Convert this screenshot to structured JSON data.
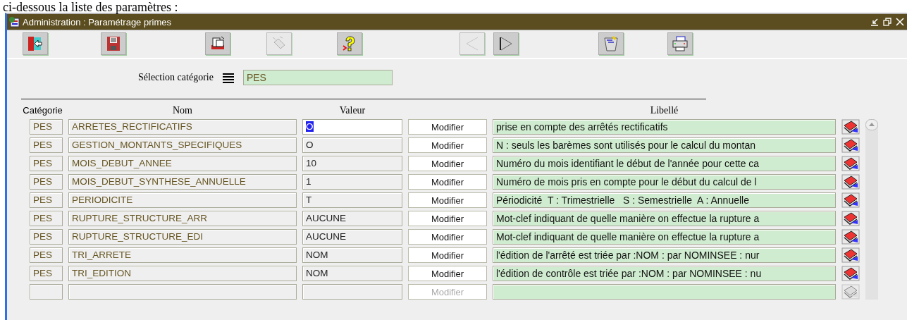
{
  "page_caption": "ci-dessous la liste des paramètres :",
  "window": {
    "title": "Administration : Paramétrage primes"
  },
  "toolbar": [
    {
      "kind": "exit",
      "disabled": false
    },
    {
      "kind": "save",
      "disabled": false
    },
    {
      "kind": "copy",
      "disabled": false
    },
    {
      "kind": "eraser",
      "disabled": true
    },
    {
      "kind": "help",
      "disabled": false
    },
    {
      "kind": "previous",
      "disabled": true
    },
    {
      "kind": "next",
      "disabled": false
    },
    {
      "kind": "trash",
      "disabled": false
    },
    {
      "kind": "print",
      "disabled": false
    }
  ],
  "selection": {
    "label": "Sélection catégorie",
    "value": "PES"
  },
  "table": {
    "columns": [
      "Catégorie",
      "Nom",
      "Valeur",
      "Libellé"
    ],
    "rows": [
      {
        "category": "PES",
        "name": "ARRETES_RECTIFICATIFS",
        "value": "O",
        "focused": true,
        "action": "Modifier",
        "disabled": false,
        "label": "prise en compte des arrêtés rectificatifs"
      },
      {
        "category": "PES",
        "name": "GESTION_MONTANTS_SPECIFIQUES",
        "value": "O",
        "focused": false,
        "action": "Modifier",
        "disabled": false,
        "label": "N : seuls les barèmes sont utilisés pour le calcul du montan"
      },
      {
        "category": "PES",
        "name": "MOIS_DEBUT_ANNEE",
        "value": "10",
        "focused": false,
        "action": "Modifier",
        "disabled": false,
        "label": "Numéro du mois identifiant le début de l'année pour cette ca"
      },
      {
        "category": "PES",
        "name": "MOIS_DEBUT_SYNTHESE_ANNUELLE",
        "value": "1",
        "focused": false,
        "action": "Modifier",
        "disabled": false,
        "label": "Numéro de mois pris en compte pour le début du calcul de l"
      },
      {
        "category": "PES",
        "name": "PERIODICITE",
        "value": "T",
        "focused": false,
        "action": "Modifier",
        "disabled": false,
        "label": "Périodicité  T : Trimestrielle   S : Semestrielle  A : Annuelle"
      },
      {
        "category": "PES",
        "name": "RUPTURE_STRUCTURE_ARR",
        "value": "AUCUNE",
        "focused": false,
        "action": "Modifier",
        "disabled": false,
        "label": "Mot-clef indiquant de quelle manière on effectue la rupture a"
      },
      {
        "category": "PES",
        "name": "RUPTURE_STRUCTURE_EDI",
        "value": "AUCUNE",
        "focused": false,
        "action": "Modifier",
        "disabled": false,
        "label": "Mot-clef indiquant de quelle manière on effectue la rupture a"
      },
      {
        "category": "PES",
        "name": "TRI_ARRETE",
        "value": "NOM",
        "focused": false,
        "action": "Modifier",
        "disabled": false,
        "label": "l'édition de l'arrêté est triée par :NOM : par NOMINSEE : nur"
      },
      {
        "category": "PES",
        "name": "TRI_EDITION",
        "value": "NOM",
        "focused": false,
        "action": "Modifier",
        "disabled": false,
        "label": "l'édition de contrôle est triée par :NOM : par NOMINSEE : nu"
      },
      {
        "focused": false,
        "action": "Modifier",
        "disabled": true
      }
    ]
  }
}
